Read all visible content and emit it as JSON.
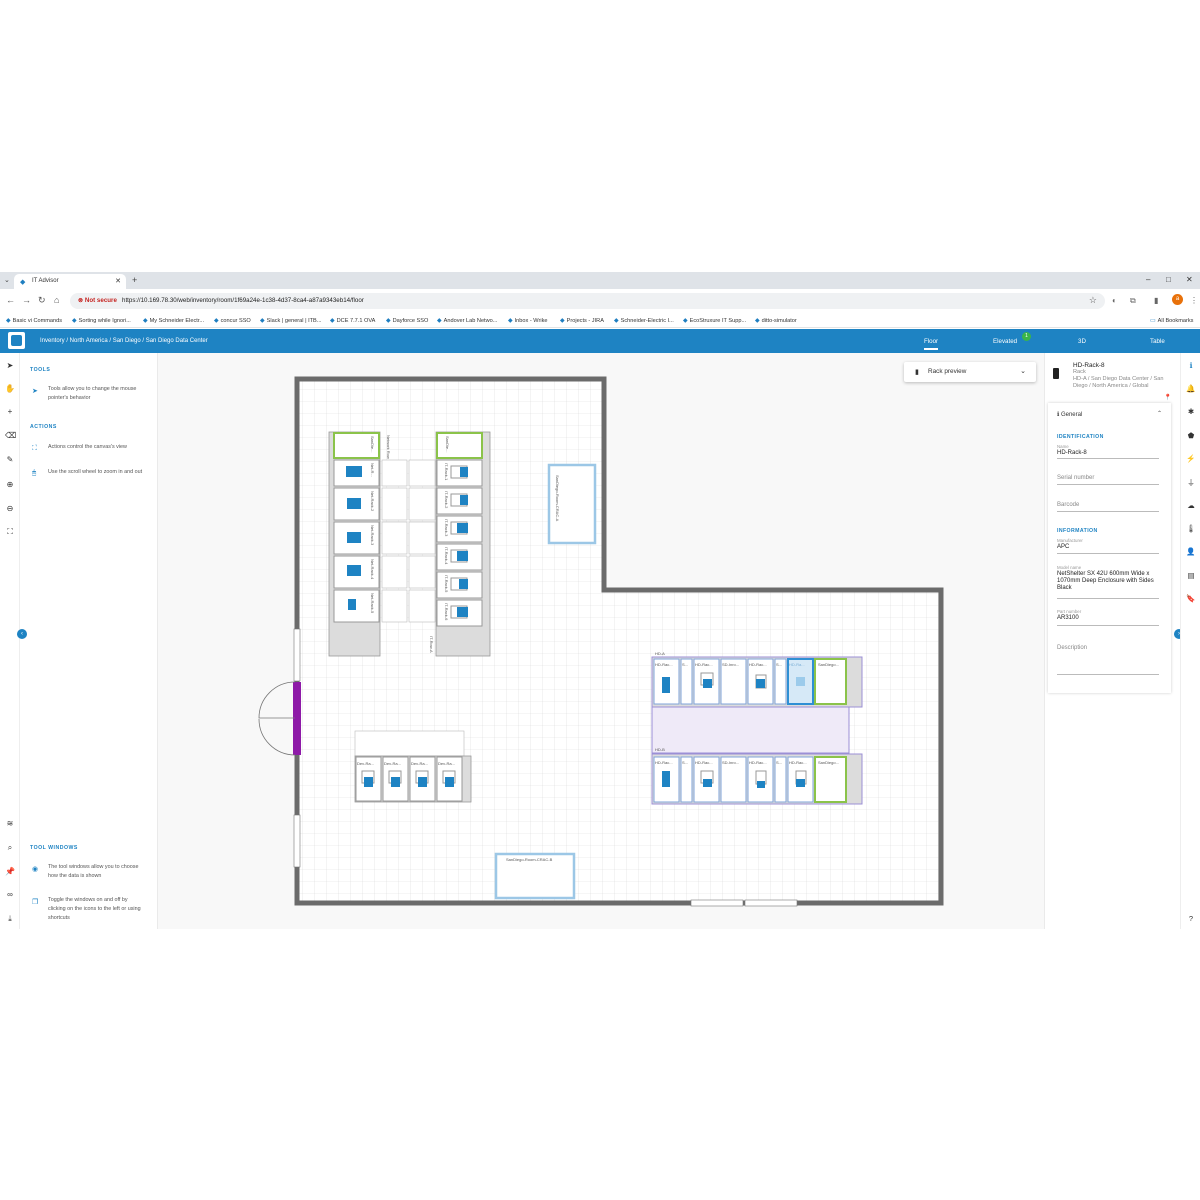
{
  "browser": {
    "tab_title": "IT Advisor",
    "not_secure": "Not secure",
    "url": "https://10.169.78.30/web/inventory/room/1f69a24e-1c38-4d37-8ca4-a87a9343eb14/floor",
    "bookmarks": [
      "Basic vi Commands",
      "Sorting while Ignori...",
      "My Schneider Electr...",
      "concur SSO",
      "Slack | general | ITB...",
      "DCE 7.7.1 OVA",
      "Dayforce SSO",
      "Andover Lab Netwo...",
      "Inbox - Wrike",
      "Projects - JIRA",
      "Schneider-Electric I...",
      "EcoStruxure IT Supp...",
      "ditto-simulator"
    ],
    "all_bookmarks": "All Bookmarks",
    "profile_initial": "a"
  },
  "app": {
    "breadcrumb": "Inventory / North America / San Diego / San Diego Data Center",
    "views": [
      "Floor",
      "Elevated",
      "3D",
      "Table"
    ],
    "elevated_badge": "1",
    "accent": "#1e83c3"
  },
  "left_panel": {
    "tools_heading": "TOOLS",
    "tools_text": "Tools allow you to change the mouse pointer's behavior",
    "actions_heading": "ACTIONS",
    "actions_text_1": "Actions control the canvas's view",
    "actions_text_2": "Use the scroll wheel to zoom in and out",
    "tool_windows_heading": "TOOL WINDOWS",
    "tool_windows_text_1": "The tool windows allow you to choose how the data is shown",
    "tool_windows_text_2": "Toggle the windows on and off by clicking on the icons to the left or using shortcuts"
  },
  "canvas": {
    "rack_preview": "Rack preview",
    "labels": {
      "network_row": "Network Row",
      "it_row_a": "IT-Row-A",
      "crac_a": "SanDiego-Room-CRAC-A",
      "crac_b": "SanDiego-Room-CRAC-B",
      "dev_row_a": "Dev-Row-A",
      "hd_a": "HD-A",
      "hd_b": "HD-B",
      "san_left": "SanDie...",
      "san_right": "SanDie..."
    },
    "net_racks": [
      "Net-R...",
      "Net-Rack-2",
      "Net-Rack-3",
      "Net-Rack-4",
      "Net-Rack-5"
    ],
    "it_racks": [
      "IT-Rack-1",
      "IT-Rack-2",
      "IT-Rack-3",
      "IT-Rack-4",
      "IT-Rack-5",
      "IT-Rack-6"
    ],
    "dev_racks": [
      "Dev-Ra...",
      "Dev-Ra...",
      "Dev-Ra...",
      "Dev-Ra..."
    ],
    "hd_a_racks": [
      "HD-Rac...",
      "S...",
      "HD-Rac...",
      "SD-Inro...",
      "HD-Rac...",
      "S...",
      "HD-Ra...",
      "SanDiego..."
    ],
    "hd_b_racks": [
      "HD-Rac...",
      "S...",
      "HD-Rac...",
      "SD-Inro...",
      "HD-Rac...",
      "S...",
      "HD-Rac...",
      "SanDiego..."
    ]
  },
  "details": {
    "name": "HD-Rack-8",
    "type": "Rack",
    "path": "HD-A / San Diego Data Center / San Diego / North America / Global",
    "section": "General",
    "identification": "IDENTIFICATION",
    "name_label": "Name",
    "name_value": "HD-Rack-8",
    "serial_placeholder": "Serial number",
    "barcode_placeholder": "Barcode",
    "information": "INFORMATION",
    "manufacturer_label": "Manufacturer",
    "manufacturer_value": "APC",
    "model_label": "Model name",
    "model_value": "NetShelter SX 42U 600mm Wide x 1070mm Deep Enclosure with Sides Black",
    "part_label": "Part number",
    "part_value": "AR3100",
    "description_placeholder": "Description"
  }
}
